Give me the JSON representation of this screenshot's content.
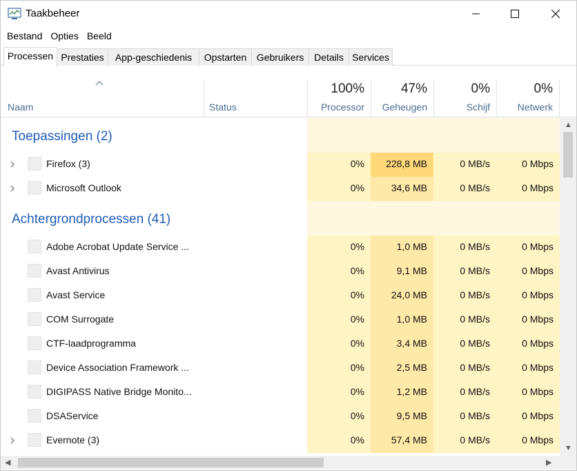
{
  "window": {
    "title": "Taakbeheer"
  },
  "menu": [
    "Bestand",
    "Opties",
    "Beeld"
  ],
  "tabs": [
    "Processen",
    "Prestaties",
    "App-geschiedenis",
    "Opstarten",
    "Gebruikers",
    "Details",
    "Services"
  ],
  "active_tab": 0,
  "columns": {
    "name": "Naam",
    "status": "Status",
    "processor": {
      "percent": "100%",
      "label": "Processor"
    },
    "memory": {
      "percent": "47%",
      "label": "Geheugen"
    },
    "disk": {
      "percent": "0%",
      "label": "Schijf"
    },
    "network": {
      "percent": "0%",
      "label": "Netwerk"
    }
  },
  "groups": [
    {
      "title": "Toepassingen (2)",
      "rows": [
        {
          "name": "Firefox (3)",
          "expandable": true,
          "cpu": "0%",
          "memory": "228,8 MB",
          "disk": "0 MB/s",
          "network": "0 Mbps",
          "mem_highlight": true
        },
        {
          "name": "Microsoft Outlook",
          "expandable": true,
          "cpu": "0%",
          "memory": "34,6 MB",
          "disk": "0 MB/s",
          "network": "0 Mbps",
          "mem_highlight": false
        }
      ]
    },
    {
      "title": "Achtergrondprocessen (41)",
      "rows": [
        {
          "name": "Adobe Acrobat Update Service ...",
          "expandable": false,
          "cpu": "0%",
          "memory": "1,0 MB",
          "disk": "0 MB/s",
          "network": "0 Mbps",
          "mem_highlight": false
        },
        {
          "name": "Avast Antivirus",
          "expandable": false,
          "cpu": "0%",
          "memory": "9,1 MB",
          "disk": "0 MB/s",
          "network": "0 Mbps",
          "mem_highlight": false
        },
        {
          "name": "Avast Service",
          "expandable": false,
          "cpu": "0%",
          "memory": "24,0 MB",
          "disk": "0 MB/s",
          "network": "0 Mbps",
          "mem_highlight": false
        },
        {
          "name": "COM Surrogate",
          "expandable": false,
          "cpu": "0%",
          "memory": "1,0 MB",
          "disk": "0 MB/s",
          "network": "0 Mbps",
          "mem_highlight": false
        },
        {
          "name": "CTF-laadprogramma",
          "expandable": false,
          "cpu": "0%",
          "memory": "3,4 MB",
          "disk": "0 MB/s",
          "network": "0 Mbps",
          "mem_highlight": false
        },
        {
          "name": "Device Association Framework ...",
          "expandable": false,
          "cpu": "0%",
          "memory": "2,5 MB",
          "disk": "0 MB/s",
          "network": "0 Mbps",
          "mem_highlight": false
        },
        {
          "name": "DIGIPASS Native Bridge Monito...",
          "expandable": false,
          "cpu": "0%",
          "memory": "1,2 MB",
          "disk": "0 MB/s",
          "network": "0 Mbps",
          "mem_highlight": false
        },
        {
          "name": "DSAService",
          "expandable": false,
          "cpu": "0%",
          "memory": "9,5 MB",
          "disk": "0 MB/s",
          "network": "0 Mbps",
          "mem_highlight": false
        },
        {
          "name": "Evernote (3)",
          "expandable": true,
          "cpu": "0%",
          "memory": "57,4 MB",
          "disk": "0 MB/s",
          "network": "0 Mbps",
          "mem_highlight": false
        }
      ]
    }
  ],
  "colors": {
    "heat_light": "#fff4c4",
    "heat_mid": "#ffe9a8",
    "heat_strong": "#ffd87a",
    "group_title": "#1f5bb7"
  }
}
